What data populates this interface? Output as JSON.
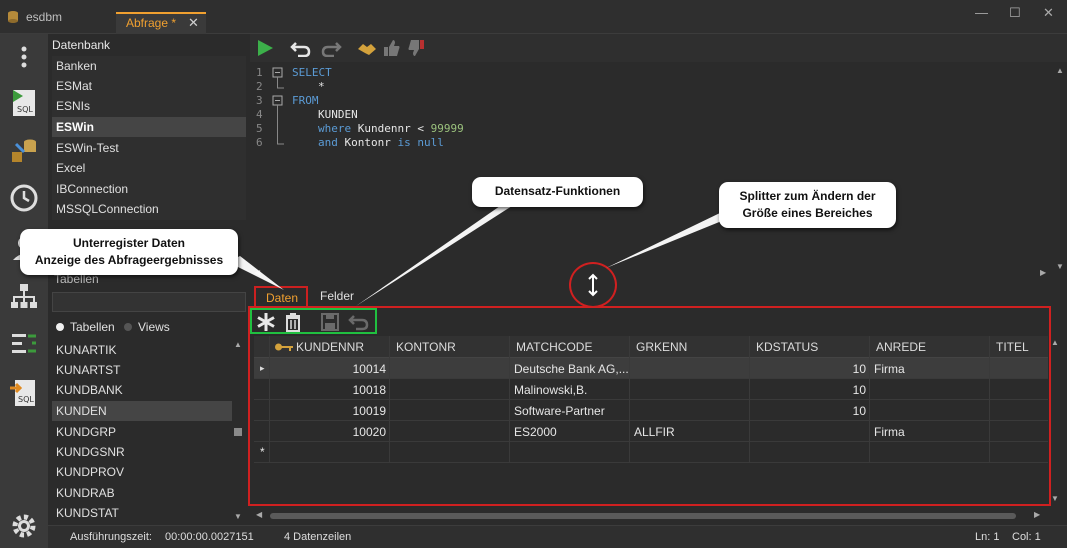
{
  "app": {
    "title": "esdbm"
  },
  "tabs": [
    {
      "label": "Abfrage *",
      "close": "✕"
    }
  ],
  "window": {
    "minimize": "—",
    "maximize": "☐",
    "close": "✕"
  },
  "db_panel": {
    "header": "Datenbank",
    "items": [
      "Banken",
      "ESMat",
      "ESNIs",
      "ESWin",
      "ESWin-Test",
      "Excel",
      "IBConnection",
      "MSSQLConnection"
    ],
    "selected": "ESWin",
    "tables_label": "Tabellen",
    "radio_tables": "Tabellen",
    "radio_views": "Views",
    "tables": [
      "KUNARTIK",
      "KUNARTST",
      "KUNDBANK",
      "KUNDEN",
      "KUNDGRP",
      "KUNDGSNR",
      "KUNDPROV",
      "KUNDRAB",
      "KUNDSTAT"
    ],
    "selected_table": "KUNDEN"
  },
  "editor": {
    "line_numbers": [
      "1",
      "2",
      "3",
      "4",
      "5",
      "6"
    ],
    "lines": {
      "l1_kw": "SELECT",
      "l2": "*",
      "l3_kw": "FROM",
      "l4": "KUNDEN",
      "l5_kw": "where",
      "l5_mid": " Kundennr < ",
      "l5_num": "99999",
      "l6_kw": "and",
      "l6_mid": " Kontonr ",
      "l6_kw2": "is null"
    }
  },
  "result_tabs": {
    "data": "Daten",
    "fields": "Felder"
  },
  "grid": {
    "columns": [
      "KUNDENNR",
      "KONTONR",
      "MATCHCODE",
      "GRKENN",
      "KDSTATUS",
      "ANREDE",
      "TITEL"
    ],
    "rows": [
      {
        "kundennr": "10014",
        "kontonr": "",
        "matchcode": "Deutsche Bank AG,...",
        "grkenn": "",
        "kdstatus": "10",
        "anrede": "Firma",
        "titel": ""
      },
      {
        "kundennr": "10018",
        "kontonr": "",
        "matchcode": "Malinowski,B.",
        "grkenn": "",
        "kdstatus": "10",
        "anrede": "",
        "titel": ""
      },
      {
        "kundennr": "10019",
        "kontonr": "",
        "matchcode": "Software-Partner",
        "grkenn": "",
        "kdstatus": "10",
        "anrede": "",
        "titel": ""
      },
      {
        "kundennr": "10020",
        "kontonr": "",
        "matchcode": "ES2000",
        "grkenn": "ALLFIR",
        "kdstatus": "",
        "anrede": "Firma",
        "titel": ""
      }
    ],
    "current_row_marker": "▸",
    "new_row_marker": "*"
  },
  "status": {
    "exec_label": "Ausführungszeit:",
    "exec_time": "00:00:00.0027151",
    "rows": "4 Datenzeilen",
    "ln": "Ln: 1",
    "col": "Col: 1"
  },
  "callouts": {
    "unterregister": "Unterregister Daten\nAnzeige des Abfrageergebnisses",
    "datensatz": "Datensatz-Funktionen",
    "splitter": "Splitter zum Ändern der\nGröße eines Bereiches"
  },
  "colors": {
    "accent": "#f0a030",
    "highlight_red": "#d02020",
    "highlight_green": "#20c040",
    "sql_keyword": "#5b9bd5",
    "sql_number": "#9bc27d"
  }
}
